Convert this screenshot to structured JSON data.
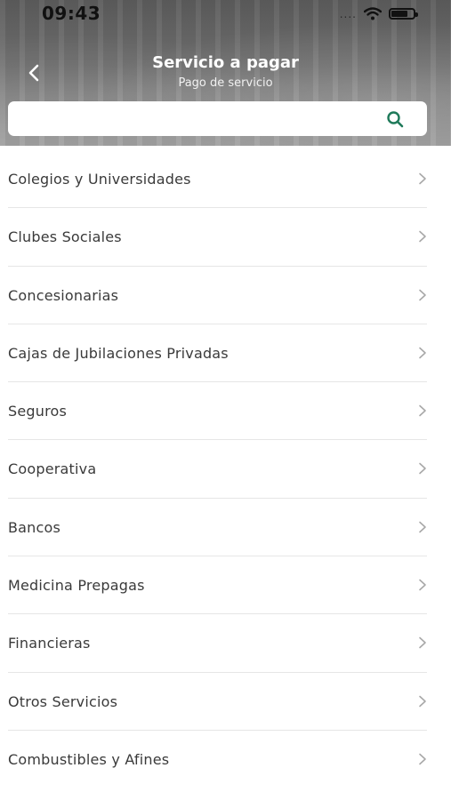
{
  "status_bar": {
    "time": "09:43",
    "signal": "....",
    "wifi_icon": "wifi-icon",
    "battery_icon": "battery-icon"
  },
  "header": {
    "title": "Servicio a pagar",
    "subtitle": "Pago de servicio",
    "back_icon": "chevron-left-icon"
  },
  "search": {
    "value": "",
    "placeholder": "",
    "icon": "search-icon",
    "icon_color": "#1f7a5a"
  },
  "categories": [
    {
      "label": "Colegios y Universidades"
    },
    {
      "label": "Clubes Sociales"
    },
    {
      "label": "Concesionarias"
    },
    {
      "label": "Cajas de Jubilaciones Privadas"
    },
    {
      "label": "Seguros"
    },
    {
      "label": "Cooperativa"
    },
    {
      "label": "Bancos"
    },
    {
      "label": "Medicina Prepagas"
    },
    {
      "label": "Financieras"
    },
    {
      "label": "Otros Servicios"
    },
    {
      "label": "Combustibles y Afines"
    }
  ]
}
